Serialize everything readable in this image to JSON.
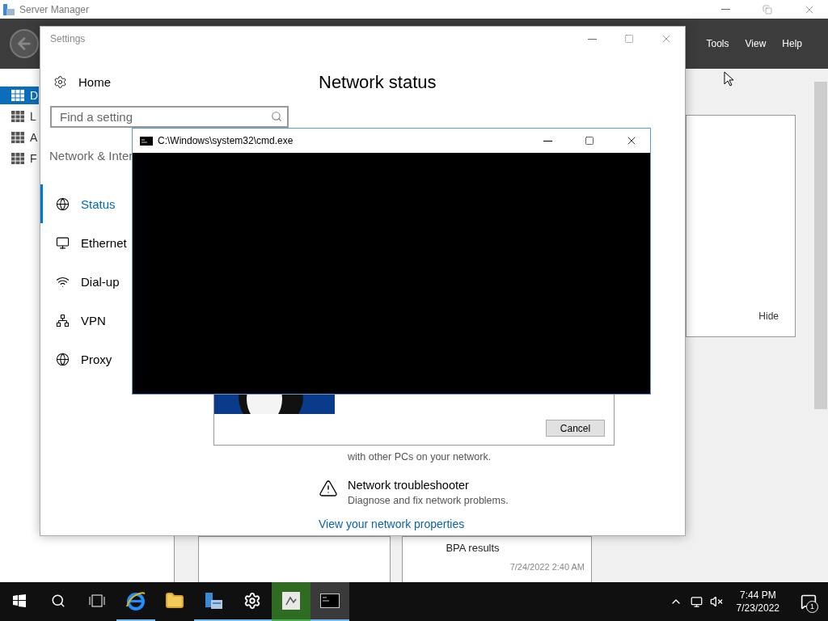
{
  "server_manager": {
    "title": "Server Manager",
    "menu": [
      "Tools",
      "View",
      "Help"
    ],
    "nav": [
      {
        "label": "D",
        "selected": true
      },
      {
        "label": "L",
        "selected": false
      },
      {
        "label": "A",
        "selected": false
      },
      {
        "label": "F",
        "selected": false
      }
    ],
    "panel": {
      "hide": "Hide"
    },
    "tiles": [
      {
        "title": "BPA results",
        "timestamp": "7/24/2022 2:40 AM"
      }
    ]
  },
  "settings": {
    "title": "Settings",
    "home": "Home",
    "search": {
      "placeholder": "Find a setting"
    },
    "section": "Network & Inter",
    "nav": [
      {
        "label": "Status",
        "kind": "globe",
        "selected": true
      },
      {
        "label": "Ethernet",
        "kind": "ethernet",
        "selected": false
      },
      {
        "label": "Dial-up",
        "kind": "dialup",
        "selected": false
      },
      {
        "label": "VPN",
        "kind": "vpn",
        "selected": false
      },
      {
        "label": "Proxy",
        "kind": "globe",
        "selected": false
      }
    ],
    "heading": "Network status",
    "homegroup": "with other PCs on your network.",
    "troubleshooter": {
      "title": "Network troubleshooter",
      "description": "Diagnose and fix network problems."
    },
    "link": "View your network properties"
  },
  "dialog": {
    "button": "Cancel"
  },
  "cmd": {
    "title": "C:\\Windows\\system32\\cmd.exe"
  },
  "taskbar": {
    "apps": [
      {
        "kind": "ie",
        "running": true,
        "selected": false,
        "flashing": false
      },
      {
        "kind": "folder",
        "running": false,
        "selected": false,
        "flashing": false
      },
      {
        "kind": "server",
        "running": true,
        "selected": false,
        "flashing": false
      },
      {
        "kind": "gear",
        "running": true,
        "selected": false,
        "flashing": false
      },
      {
        "kind": "app",
        "running": true,
        "selected": false,
        "flashing": true
      },
      {
        "kind": "cmd",
        "running": true,
        "selected": true,
        "flashing": false
      }
    ],
    "time": "7:44 PM",
    "date": "7/23/2022",
    "notifications": "1"
  }
}
